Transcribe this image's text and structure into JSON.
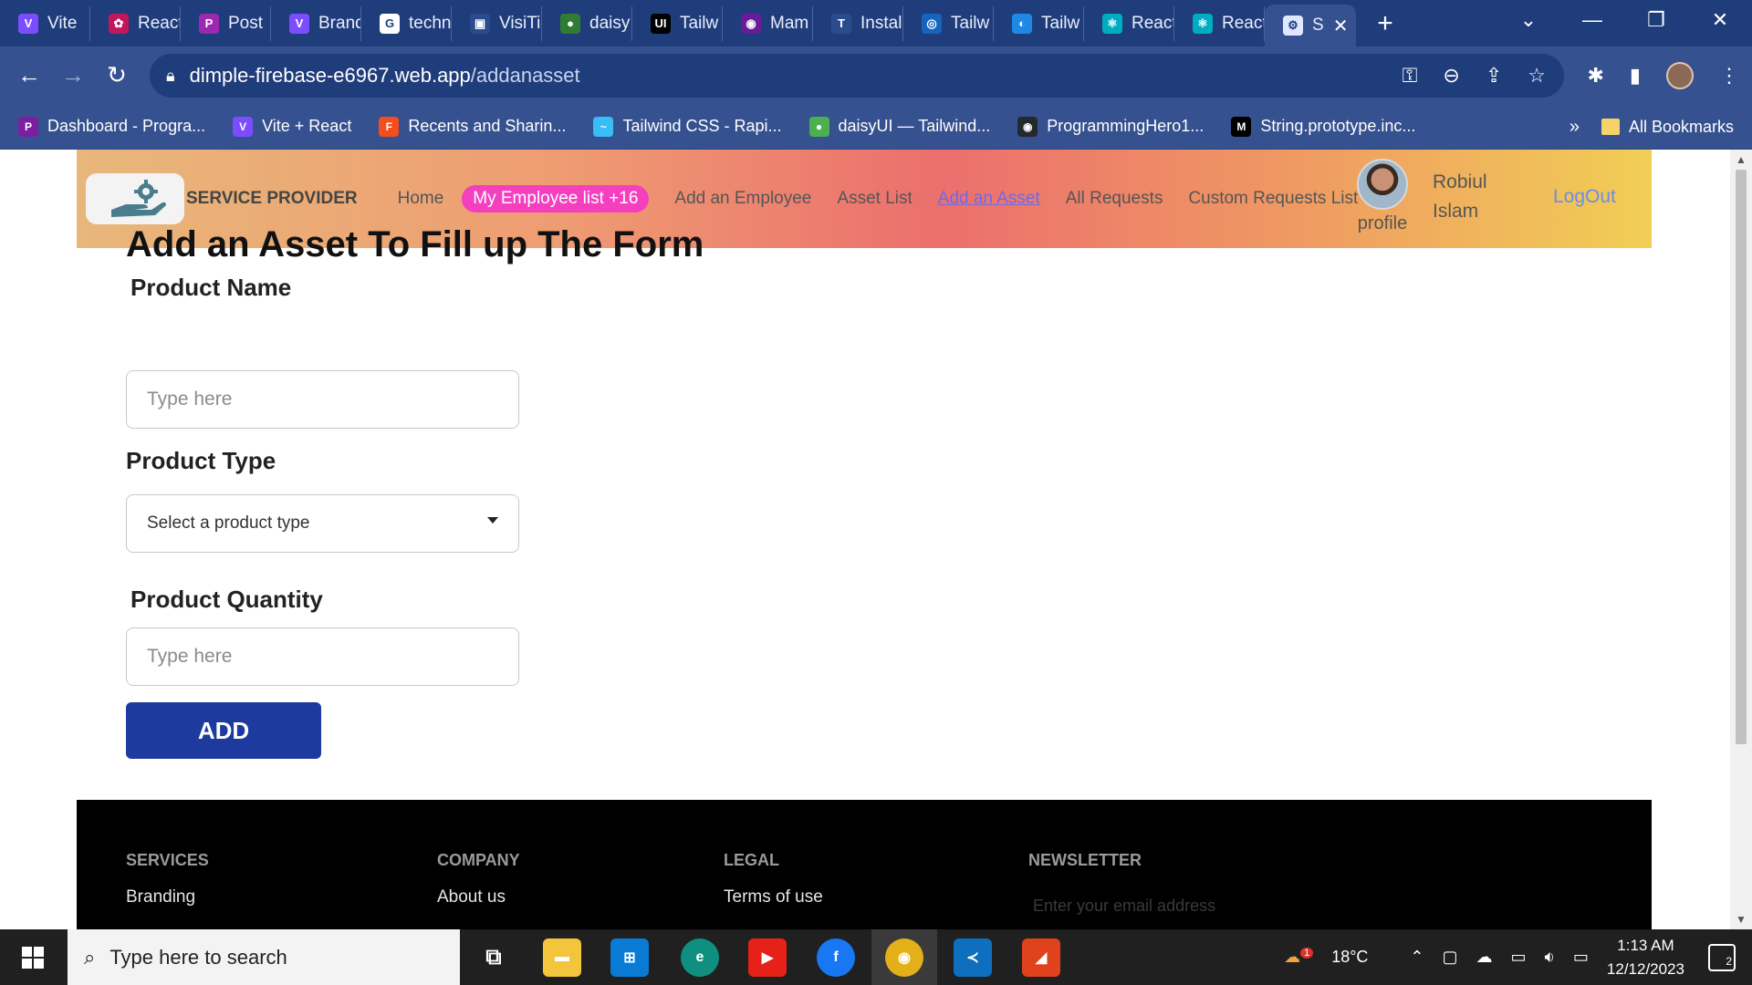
{
  "browser": {
    "tabs": [
      {
        "label": "Vite",
        "color": "#7c4dff",
        "glyph": "V"
      },
      {
        "label": "React",
        "color": "#c2185b",
        "glyph": "✿"
      },
      {
        "label": "Post",
        "color": "#9c27b0",
        "glyph": "P"
      },
      {
        "label": "Brand",
        "color": "#7c4dff",
        "glyph": "V"
      },
      {
        "label": "techn",
        "color": "#ffffff",
        "glyph": "G"
      },
      {
        "label": "VisiTi",
        "color": "#2b4c8c",
        "glyph": "▣"
      },
      {
        "label": "daisy",
        "color": "#2e7d32",
        "glyph": "●"
      },
      {
        "label": "Tailw",
        "color": "#000000",
        "glyph": "UI"
      },
      {
        "label": "Mam",
        "color": "#6a1b9a",
        "glyph": "◉"
      },
      {
        "label": "Instal",
        "color": "#2b4c8c",
        "glyph": "T"
      },
      {
        "label": "Tailw",
        "color": "#1565c0",
        "glyph": "◎"
      },
      {
        "label": "Tailw",
        "color": "#1e88e5",
        "glyph": "◐"
      },
      {
        "label": "React",
        "color": "#00acc1",
        "glyph": "⚛"
      },
      {
        "label": "React",
        "color": "#00acc1",
        "glyph": "⚛"
      }
    ],
    "active_tab": {
      "label": "S",
      "glyph": "⚙"
    },
    "url_host": "dimple-firebase-e6967.web.app",
    "url_path": "/addanasset",
    "bookmarks": [
      {
        "label": "Dashboard - Progra...",
        "color": "#7b1fa2",
        "glyph": "P"
      },
      {
        "label": "Vite + React",
        "color": "#7c4dff",
        "glyph": "V"
      },
      {
        "label": "Recents and Sharin...",
        "color": "#f24e1e",
        "glyph": "F"
      },
      {
        "label": "Tailwind CSS - Rapi...",
        "color": "#38bdf8",
        "glyph": "~"
      },
      {
        "label": "daisyUI — Tailwind...",
        "color": "#4caf50",
        "glyph": "●"
      },
      {
        "label": "ProgrammingHero1...",
        "color": "#24292e",
        "glyph": "◉"
      },
      {
        "label": "String.prototype.inc...",
        "color": "#000000",
        "glyph": "M"
      }
    ],
    "more_bookmarks": "»",
    "all_bookmarks": "All Bookmarks"
  },
  "site": {
    "brand": "SERVICE PROVIDER",
    "nav": {
      "home": "Home",
      "employee_list": "My Employee list +16",
      "add_employee": "Add an Employee",
      "asset_list": "Asset List",
      "add_asset": "Add an Asset",
      "all_requests": "All Requests",
      "custom_requests": "Custom Requests List"
    },
    "profile_label": "profile",
    "user_name": "Robiul Islam",
    "logout": "LogOut"
  },
  "form": {
    "heading": "Add an Asset To Fill up The Form",
    "product_name_label": "Product Name",
    "product_name_placeholder": "Type here",
    "product_type_label": "Product Type",
    "product_type_selected": "Select a product type",
    "product_quantity_label": "Product Quantity",
    "product_quantity_placeholder": "Type here",
    "submit_label": "ADD"
  },
  "footer": {
    "services_heading": "SERVICES",
    "services_first": "Branding",
    "company_heading": "COMPANY",
    "company_first": "About us",
    "legal_heading": "LEGAL",
    "legal_first": "Terms of use",
    "newsletter_heading": "NEWSLETTER",
    "newsletter_placeholder": "Enter your email address"
  },
  "taskbar": {
    "search_placeholder": "Type here to search",
    "weather": "18°C",
    "time": "1:13 AM",
    "date": "12/12/2023",
    "notification_count": "2",
    "weather_badge": "1"
  }
}
